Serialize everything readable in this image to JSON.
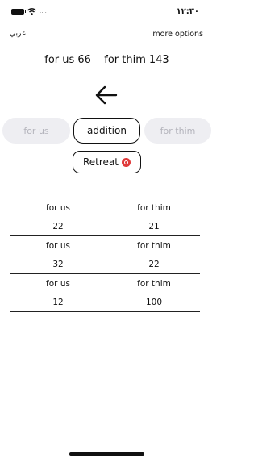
{
  "status_bar": {
    "time": "١٢:٣٠",
    "signal": "....",
    "icons": [
      "battery-icon",
      "wifi-icon"
    ]
  },
  "top_bar": {
    "language_label": "عربي",
    "options_label": "more options"
  },
  "score": {
    "us_label": "for us",
    "us_total": "66",
    "thim_label": "for thim",
    "thim_total": "143"
  },
  "controls": {
    "back_icon": "arrow-left-icon",
    "us_button": "for us",
    "addition_button": "addition",
    "thim_button": "for thim",
    "retreat_button": "Retreat",
    "retreat_icon": "remove-circle-icon"
  },
  "table": {
    "rows": [
      {
        "us_label": "for us",
        "us_value": "22",
        "thim_label": "for thim",
        "thim_value": "21"
      },
      {
        "us_label": "for us",
        "us_value": "32",
        "thim_label": "for thim",
        "thim_value": "22"
      },
      {
        "us_label": "for us",
        "us_value": "12",
        "thim_label": "for thim",
        "thim_value": "100"
      }
    ]
  },
  "colors": {
    "accent": "#111111",
    "disabled_bg": "#eeeef2",
    "disabled_text": "#b4b4bc",
    "danger": "#e03a3a"
  }
}
